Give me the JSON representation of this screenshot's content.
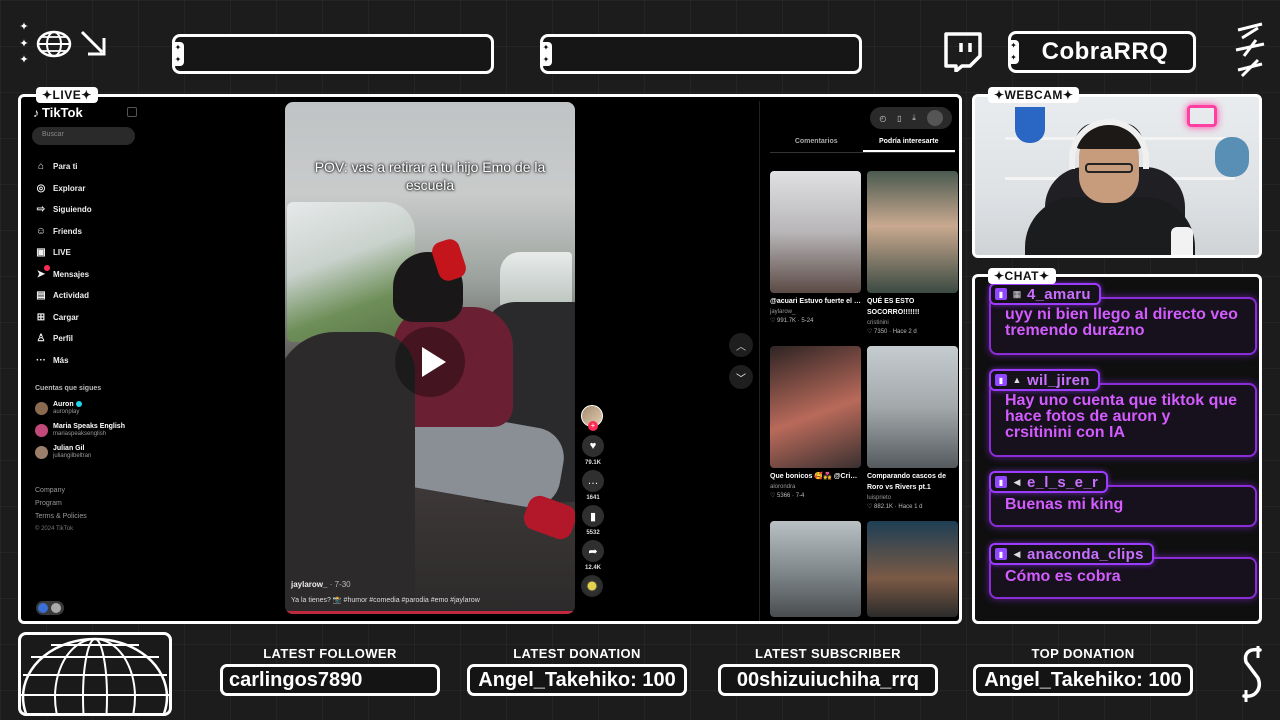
{
  "header": {
    "channel_name": "CobraRRQ"
  },
  "live_frame": {
    "label": "✦LIVE✦"
  },
  "tiktok": {
    "logo": "TikTok",
    "search_placeholder": "Buscar",
    "nav": [
      {
        "label": "Para ti",
        "icon": "home-icon"
      },
      {
        "label": "Explorar",
        "icon": "compass-icon"
      },
      {
        "label": "Siguiendo",
        "icon": "following-icon"
      },
      {
        "label": "Friends",
        "icon": "friends-icon"
      },
      {
        "label": "LIVE",
        "icon": "live-icon"
      },
      {
        "label": "Mensajes",
        "icon": "messages-icon"
      },
      {
        "label": "Actividad",
        "icon": "activity-icon"
      },
      {
        "label": "Cargar",
        "icon": "upload-icon"
      },
      {
        "label": "Perfil",
        "icon": "profile-icon"
      },
      {
        "label": "Más",
        "icon": "more-icon"
      }
    ],
    "following_title": "Cuentas que sigues",
    "following": [
      {
        "name": "Auron",
        "handle": "auronplay",
        "verified": true,
        "color": "#8b6b4f"
      },
      {
        "name": "Maria Speaks English",
        "handle": "mariaspeaksenglish",
        "verified": false,
        "color": "#c24a7a"
      },
      {
        "name": "Julian Gil",
        "handle": "juliangilbeltran",
        "verified": false,
        "color": "#9c7f6a"
      }
    ],
    "footer": {
      "company": "Company",
      "program": "Program",
      "terms": "Terms & Policies",
      "copyright": "© 2024 TikTok"
    },
    "video": {
      "caption": "POV: vas a retirar a tu hijo Emo de la escuela",
      "author": "jaylarow_",
      "date": "· 7-30",
      "description": "Ya la tienes? 📸 #humor #comedia #parodia #emo #jaylarow"
    },
    "rail": {
      "likes": "79.1K",
      "comments": "1641",
      "saves": "5532",
      "shares": "12.4K"
    },
    "tabs": [
      "Comentarios",
      "Podría interesarte"
    ],
    "active_tab": 1,
    "cards": [
      {
        "title": "@acuari Estuvo fuerte el cringe 🗿 si o no m...",
        "author": "jaylarow_",
        "stats": "♡ 991.7K · 5-24",
        "colors": [
          "#d8d8da",
          "#5b4a45"
        ]
      },
      {
        "title": "QUÉ ES ESTO SOCORRO!!!!!!!",
        "author": "cristinini",
        "stats": "♡ 7350 · Hace 2 d",
        "colors": [
          "#3b4a42",
          "#c9a98f"
        ]
      },
      {
        "title": "Que bonicos 🥰💑 @Cristinini @Auron...",
        "author": "alorondra",
        "stats": "♡ 5366 · 7-4",
        "colors": [
          "#3a3030",
          "#b96a5a"
        ]
      },
      {
        "title": "Comparando cascos de Roro vs Rivers pt.1",
        "author": "luisprieto",
        "stats": "♡ 882.1K · Hace 1 d",
        "colors": [
          "#b8c0c4",
          "#555a5e"
        ]
      },
      {
        "title": "",
        "author": "",
        "stats": "",
        "colors": [
          "#9aa3a8",
          "#4a4d50"
        ]
      },
      {
        "title": "",
        "author": "",
        "stats": "",
        "colors": [
          "#1e3f55",
          "#7a5a45"
        ]
      }
    ]
  },
  "webcam": {
    "label": "✦WEBCAM✦"
  },
  "chat": {
    "label": "✦CHAT✦",
    "messages": [
      {
        "user": "4_amaru",
        "text": "uyy ni bien llego al directo veo tremendo durazno"
      },
      {
        "user": "wil_jiren",
        "text": "Hay uno cuenta que tiktok que hace fotos de auron y crsitinini con IA"
      },
      {
        "user": "e_l_s_e_r",
        "text": "Buenas mi king"
      },
      {
        "user": "anaconda_clips",
        "text": "Cómo es cobra"
      }
    ]
  },
  "footer": {
    "latest_follower_label": "LATEST FOLLOWER",
    "latest_follower": "carlingos7890",
    "latest_donation_label": "LATEST DONATION",
    "latest_donation": "Angel_Takehiko: 100",
    "latest_subscriber_label": "LATEST SUBSCRIBER",
    "latest_subscriber": "00shizuiuchiha_rrq",
    "top_donation_label": "TOP DONATION",
    "top_donation": "Angel_Takehiko: 100"
  },
  "colors": {
    "background": "#1c1c1c",
    "chat_accent": "#9b3cff",
    "chat_text": "#d35cff",
    "tiktok_red": "#fe2c55"
  }
}
